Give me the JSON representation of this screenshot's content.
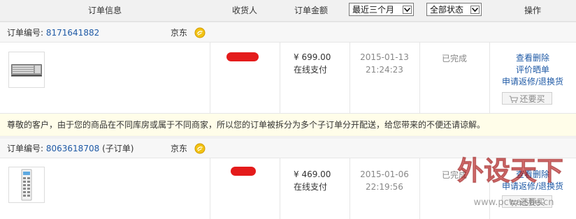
{
  "header": {
    "col_info": "订单信息",
    "col_receiver": "收货人",
    "col_amount": "订单金额",
    "time_filter": "最近三个月",
    "status_filter": "全部状态",
    "col_ops": "操作"
  },
  "orders": [
    {
      "number_label": "订单编号:",
      "number": "8171641882",
      "sub_tag": "",
      "shop": "京东",
      "amount": "¥ 699.00",
      "pay_method": "在线支付",
      "date": "2015-01-13",
      "time": "21:24:23",
      "status": "已完成",
      "actions": [
        "查看",
        "删除",
        "评价晒单",
        "申请返修/退换货"
      ],
      "rebuy_label": "还要买"
    },
    {
      "number_label": "订单编号:",
      "number": "8063618708",
      "sub_tag": "(子订单)",
      "shop": "京东",
      "amount": "¥ 469.00",
      "pay_method": "在线支付",
      "date": "2015-01-06",
      "time": "22:19:56",
      "status": "已完成",
      "actions": [
        "查看",
        "删除",
        "申请返修/退换货"
      ],
      "rebuy_label": "还要买"
    }
  ],
  "notice": "尊敬的客户，由于您的商品在不同库房或属于不同商家，所以您的订单被拆分为多个子订单分开配送，给您带来的不便还请谅解。",
  "watermark": {
    "title": "外设天下",
    "url": "www.pcwaishe.cn"
  },
  "colors": {
    "link": "#1f5aa6",
    "redaction": "#e41b1b",
    "notice_bg": "#fffde9"
  }
}
